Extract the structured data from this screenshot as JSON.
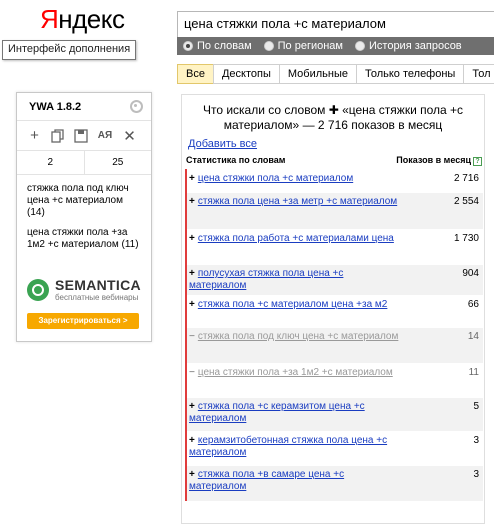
{
  "brand": {
    "logo_first": "Я",
    "logo_rest": "ндекс"
  },
  "extension_tooltip": "Интерфейс дополнения",
  "search": {
    "value": "цена стяжки пола +с материалом"
  },
  "radio": [
    {
      "label": "По словам",
      "checked": true
    },
    {
      "label": "По регионам",
      "checked": false
    },
    {
      "label": "История запросов",
      "checked": false
    }
  ],
  "tabs": [
    "Все",
    "Десктопы",
    "Мобильные",
    "Только телефоны",
    "Тол"
  ],
  "plugin": {
    "title": "YWA 1.8.2",
    "tools": {
      "plus": "+",
      "aa": "АЯ",
      "close": "✕"
    },
    "counts": [
      "2",
      "25"
    ],
    "items": [
      "стяжка пола под ключ цена +с материалом (14)",
      "цена стяжки пола +за 1м2 +с материалом (11)"
    ],
    "brand": "SEMANTICA",
    "brand_sub": "бесплатные вебинары",
    "register": "Зарегистрироваться >"
  },
  "results": {
    "title": "Что искали со словом ✚ «цена стяжки пола +с материалом» — 2 716 показов в месяц",
    "add_all": "Добавить все",
    "col_stat": "Статистика по словам",
    "col_shows": "Показов в месяц",
    "rows": [
      {
        "sign": "+",
        "phrase": "цена стяжки пола +с материалом",
        "count": "2 716"
      },
      {
        "sign": "+",
        "phrase": "стяжка пола цена +за метр +с материалом",
        "count": "2 554"
      },
      {
        "sign": "+",
        "phrase": "стяжка пола работа +с материалами цена",
        "count": "1 730"
      },
      {
        "sign": "+",
        "phrase": "полусухая стяжка пола цена +с материалом",
        "count": "904"
      },
      {
        "sign": "+",
        "phrase": "стяжка пола +с материалом цена +за м2",
        "count": "66"
      },
      {
        "sign": "−",
        "phrase": "стяжка пола под ключ цена +с материалом",
        "count": "14"
      },
      {
        "sign": "−",
        "phrase": "цена стяжки пола +за 1м2 +с материалом",
        "count": "11"
      },
      {
        "sign": "+",
        "phrase": "стяжка пола +с керамзитом цена +с материалом",
        "count": "5"
      },
      {
        "sign": "+",
        "phrase": "керамзитобетонная стяжка пола цена +с материалом",
        "count": "3"
      },
      {
        "sign": "+",
        "phrase": "стяжка пола +в самаре цена +с материалом",
        "count": "3"
      }
    ]
  }
}
